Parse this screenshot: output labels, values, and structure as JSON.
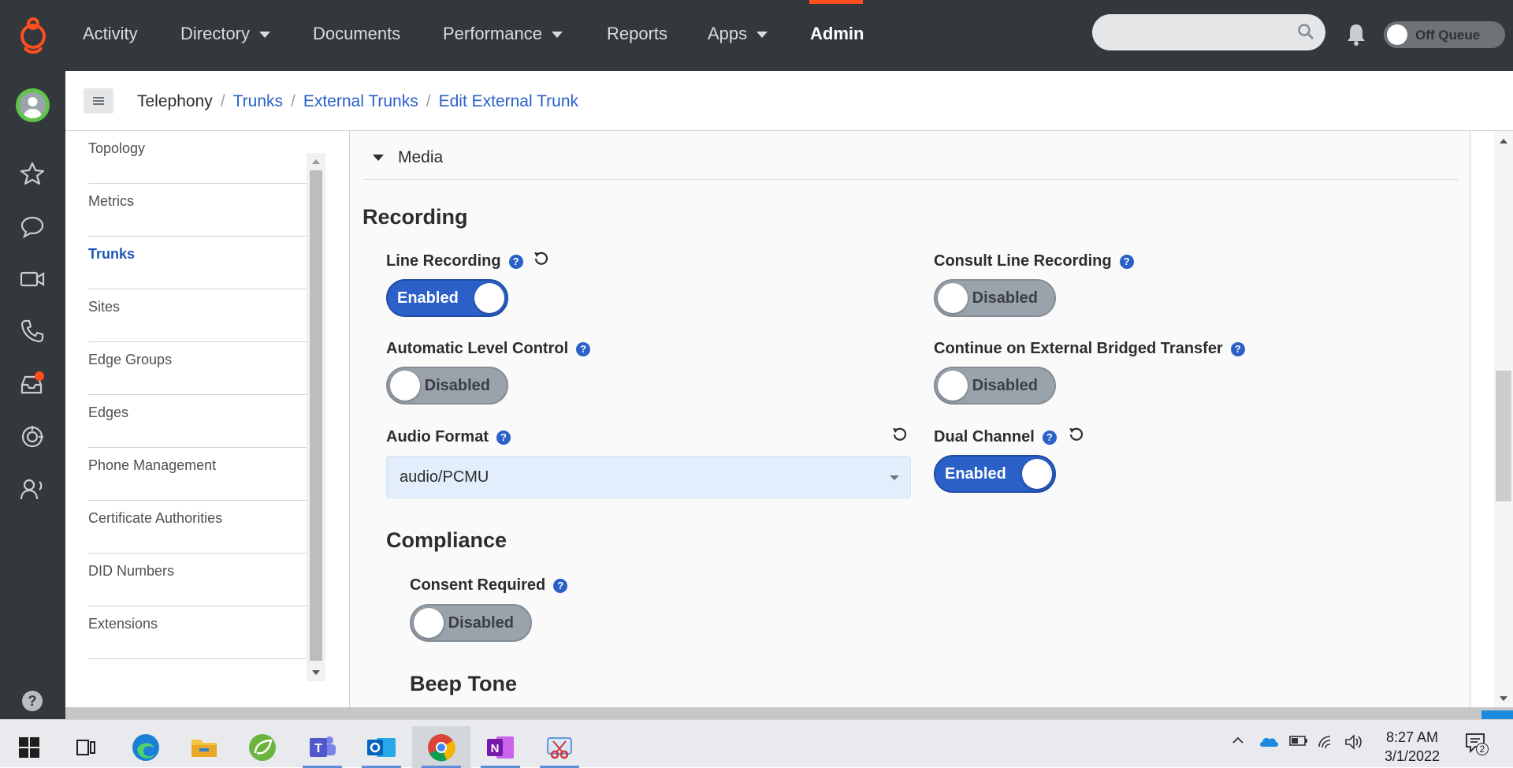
{
  "nav": {
    "items": [
      {
        "label": "Activity"
      },
      {
        "label": "Directory"
      },
      {
        "label": "Documents"
      },
      {
        "label": "Performance"
      },
      {
        "label": "Reports"
      },
      {
        "label": "Apps"
      },
      {
        "label": "Admin"
      }
    ],
    "search_placeholder": "",
    "queue_label": "Off Queue",
    "accent_color": "#ff4f1f"
  },
  "breadcrumb": [
    "Telephony",
    "Trunks",
    "External Trunks",
    "Edit External Trunk"
  ],
  "sidemenu": {
    "items": [
      "Topology",
      "Metrics",
      "Trunks",
      "Sites",
      "Edge Groups",
      "Edges",
      "Phone Management",
      "Certificate Authorities",
      "DID Numbers",
      "Extensions"
    ],
    "active": "Trunks"
  },
  "main": {
    "section": "Media",
    "recording": {
      "heading": "Recording",
      "line_recording": {
        "label": "Line Recording",
        "state": "Enabled"
      },
      "consult_line_recording": {
        "label": "Consult Line Recording",
        "state": "Disabled"
      },
      "automatic_level_control": {
        "label": "Automatic Level Control",
        "state": "Disabled"
      },
      "continue_external_bridged": {
        "label": "Continue on External Bridged Transfer",
        "state": "Disabled"
      },
      "audio_format": {
        "label": "Audio Format",
        "value": "audio/PCMU"
      },
      "dual_channel": {
        "label": "Dual Channel",
        "state": "Enabled"
      }
    },
    "compliance": {
      "heading": "Compliance",
      "consent_required": {
        "label": "Consent Required",
        "state": "Disabled"
      }
    },
    "beep_tone": {
      "heading": "Beep Tone"
    }
  },
  "help_glyph": "?",
  "taskbar": {
    "time": "8:27 AM",
    "date": "3/1/2022",
    "notification_count": "2",
    "apps": [
      "start-icon",
      "task-view-icon",
      "edge-icon",
      "file-explorer-icon",
      "spring-icon",
      "teams-icon",
      "outlook-icon",
      "chrome-icon",
      "onenote-icon",
      "snipping-tool-icon"
    ]
  },
  "colors": {
    "nav_bg": "#33383d",
    "link_blue": "#2a60c8",
    "toggle_on": "#2a60c8",
    "toggle_off": "#9aa2ab"
  }
}
